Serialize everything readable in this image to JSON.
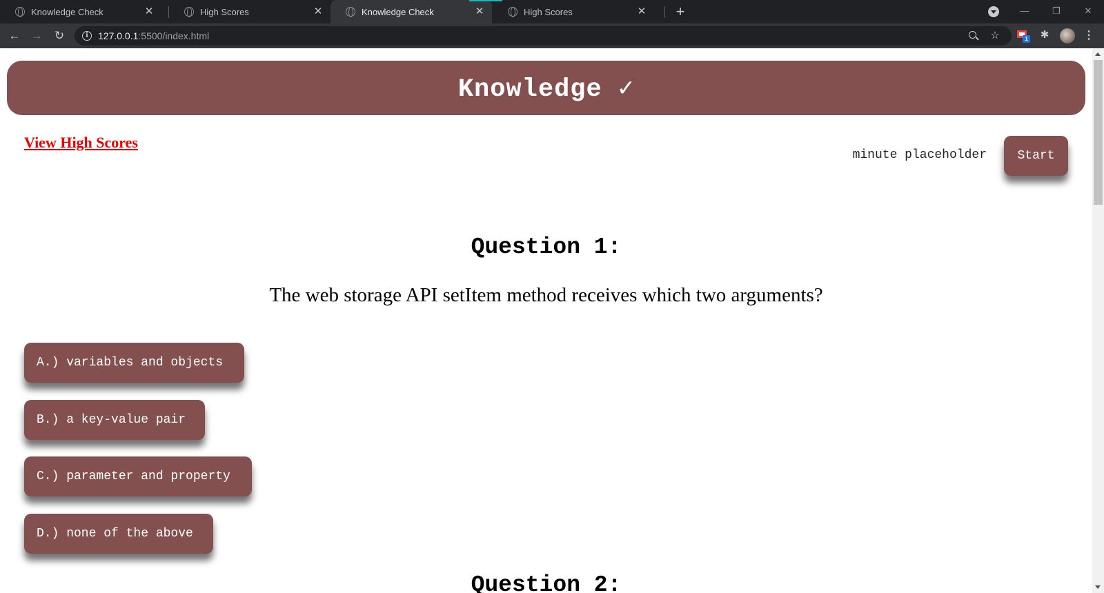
{
  "browser": {
    "tabs": [
      {
        "title": "Knowledge Check",
        "active": false
      },
      {
        "title": "High Scores",
        "active": false
      },
      {
        "title": "Knowledge Check",
        "active": true
      },
      {
        "title": "High Scores",
        "active": false
      }
    ],
    "tab_close_glyph": "✕",
    "new_tab_glyph": "+",
    "window_controls": {
      "minimize": "—",
      "restore": "❐",
      "close": "✕"
    },
    "url_host": "127.0.0.1",
    "url_rest": ":5500/index.html",
    "extension_badge": "1",
    "icons": [
      "back-icon",
      "forward-icon",
      "reload-icon",
      "info-icon",
      "zoom-icon",
      "star-icon",
      "extension-icon",
      "puzzle-icon",
      "avatar",
      "menu-icon"
    ]
  },
  "header": {
    "title": "Knowledge ✓"
  },
  "controls": {
    "high_scores_link": "View High Scores",
    "timer_text": "minute placeholder",
    "start_label": "Start"
  },
  "question": {
    "title": "Question 1:",
    "text": "The web storage API setItem method receives which two arguments?",
    "answers": [
      {
        "label": "A.) variables and objects"
      },
      {
        "label": "B.) a key-value pair"
      },
      {
        "label": "C.) parameter and property"
      },
      {
        "label": "D.) none of the above"
      }
    ]
  },
  "next_question_peek": "Question 2:",
  "colors": {
    "accent": "#84504f",
    "link": "#ee0000",
    "chrome_dark": "#202124",
    "chrome_toolbar": "#35363a"
  }
}
